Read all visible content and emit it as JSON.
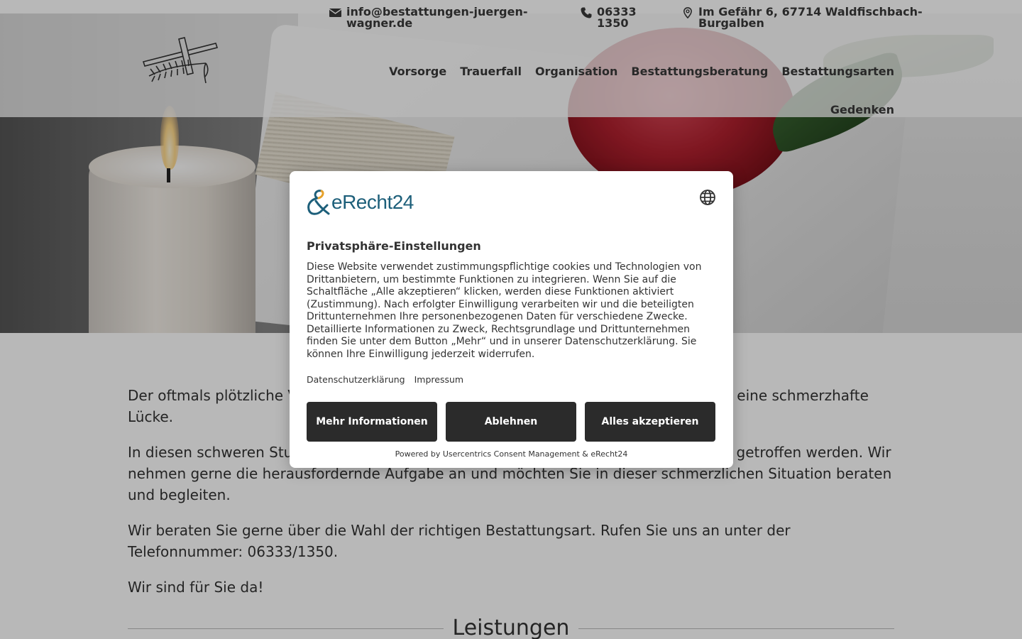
{
  "contact": {
    "email": "info@bestattungen-juergen-wagner.de",
    "phone": "06333 1350",
    "address": "Im Gefähr 6, 67714 Waldfischbach-Burgalben"
  },
  "nav": {
    "items": [
      "Vorsorge",
      "Trauerfall",
      "Organisation",
      "Bestattungsberatung",
      "Bestattungsarten",
      "Gedenken"
    ]
  },
  "content": {
    "p1": "Der oftmals plötzliche Verlust eines geliebten Menschen hinterlässt große Trauer und eine schmerzhafte Lücke.",
    "p2": "In diesen schweren Stunden müssen oft in kurzer Zeit viele wichtige Entscheidungen getroffen werden. Wir nehmen gerne die herausfordernde Aufgabe an und möchten Sie in dieser schmerzlichen Situation beraten und begleiten.",
    "p3": "Wir beraten Sie gerne über die Wahl der richtigen Bestattungsart. Rufen Sie uns an unter der Telefonnummer: 06333/1350.",
    "p4": "Wir sind für Sie da!",
    "section_title": "Leistungen"
  },
  "consent": {
    "brand": "eRecht24",
    "title": "Privatsphäre-Einstellungen",
    "description": "Diese Website verwendet zustimmungspflichtige cookies und Technologien von Drittanbietern, um bestimmte Funktionen zu integrieren. Wenn Sie auf die Schaltfläche „Alle akzeptieren“ klicken, werden diese Funktionen aktiviert (Zustimmung). Nach erfolgter Einwilligung verarbeiten wir und die beteiligten Drittunternehmen Ihre personenbezogenen Daten für verschiedene Zwecke. Detaillierte Informationen zu Zweck, Rechtsgrundlage und Drittunternehmen finden Sie unter dem Button „Mehr“ und in unserer Datenschutzerklärung. Sie können Ihre Einwilligung jederzeit widerrufen.",
    "link_privacy": "Datenschutzerklärung",
    "link_imprint": "Impressum",
    "btn_more": "Mehr Informationen",
    "btn_decline": "Ablehnen",
    "btn_accept": "Alles akzeptieren",
    "powered_by": "Powered by Usercentrics Consent Management & eRecht24",
    "brand_color": "#1d5f7a",
    "button_color": "#2b2b2b"
  },
  "icons": {
    "email": "envelope-icon",
    "phone": "phone-icon",
    "address": "map-pin-icon",
    "language": "globe-icon",
    "logo": "cross-with-palm-branch"
  }
}
